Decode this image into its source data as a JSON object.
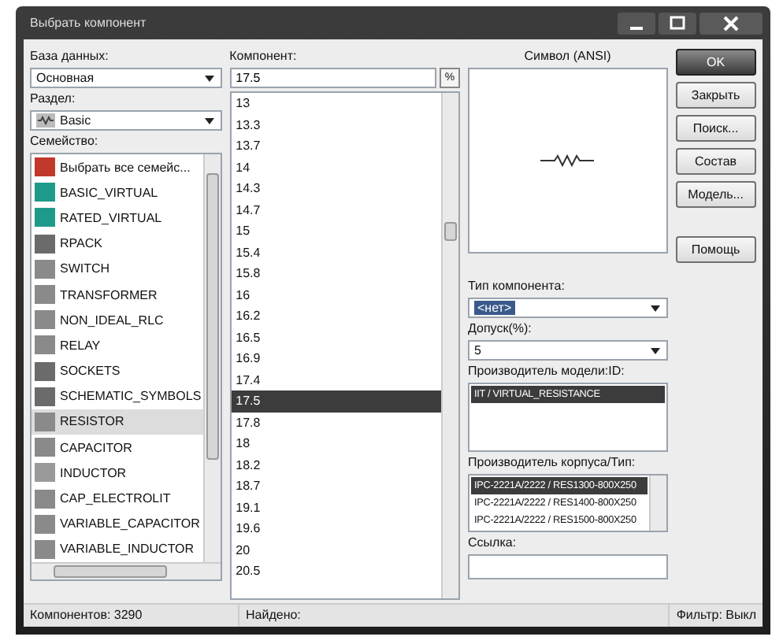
{
  "window": {
    "title": "Выбрать компонент"
  },
  "database": {
    "label": "База данных:",
    "value": "Основная"
  },
  "group": {
    "label": "Раздел:",
    "value": "Basic"
  },
  "family": {
    "label": "Семейство:",
    "items": [
      {
        "label": "Выбрать все семейс...",
        "color": "#c0392b",
        "selected": false
      },
      {
        "label": "BASIC_VIRTUAL",
        "color": "#1f9a8a",
        "selected": false
      },
      {
        "label": "RATED_VIRTUAL",
        "color": "#1f9a8a",
        "selected": false
      },
      {
        "label": "RPACK",
        "color": "#6b6b6b",
        "selected": false
      },
      {
        "label": "SWITCH",
        "color": "#8a8a8a",
        "selected": false
      },
      {
        "label": "TRANSFORMER",
        "color": "#8a8a8a",
        "selected": false
      },
      {
        "label": "NON_IDEAL_RLC",
        "color": "#8a8a8a",
        "selected": false
      },
      {
        "label": "RELAY",
        "color": "#8a8a8a",
        "selected": false
      },
      {
        "label": "SOCKETS",
        "color": "#6b6b6b",
        "selected": false
      },
      {
        "label": "SCHEMATIC_SYMBOLS",
        "color": "#6b6b6b",
        "selected": false
      },
      {
        "label": "RESISTOR",
        "color": "#8a8a8a",
        "selected": true
      },
      {
        "label": "CAPACITOR",
        "color": "#8a8a8a",
        "selected": false
      },
      {
        "label": "INDUCTOR",
        "color": "#9a9a9a",
        "selected": false
      },
      {
        "label": "CAP_ELECTROLIT",
        "color": "#8a8a8a",
        "selected": false
      },
      {
        "label": "VARIABLE_CAPACITOR",
        "color": "#8a8a8a",
        "selected": false
      },
      {
        "label": "VARIABLE_INDUCTOR",
        "color": "#8a8a8a",
        "selected": false
      }
    ]
  },
  "component": {
    "label": "Компонент:",
    "value": "17.5",
    "filter_button": "%",
    "items": [
      {
        "label": "13",
        "selected": false
      },
      {
        "label": "13.3",
        "selected": false
      },
      {
        "label": "13.7",
        "selected": false
      },
      {
        "label": "14",
        "selected": false
      },
      {
        "label": "14.3",
        "selected": false
      },
      {
        "label": "14.7",
        "selected": false
      },
      {
        "label": "15",
        "selected": false
      },
      {
        "label": "15.4",
        "selected": false
      },
      {
        "label": "15.8",
        "selected": false
      },
      {
        "label": "16",
        "selected": false
      },
      {
        "label": "16.2",
        "selected": false
      },
      {
        "label": "16.5",
        "selected": false
      },
      {
        "label": "16.9",
        "selected": false
      },
      {
        "label": "17.4",
        "selected": false
      },
      {
        "label": "17.5",
        "selected": true
      },
      {
        "label": "17.8",
        "selected": false
      },
      {
        "label": "18",
        "selected": false
      },
      {
        "label": "18.2",
        "selected": false
      },
      {
        "label": "18.7",
        "selected": false
      },
      {
        "label": "19.1",
        "selected": false
      },
      {
        "label": "19.6",
        "selected": false
      },
      {
        "label": "20",
        "selected": false
      },
      {
        "label": "20.5",
        "selected": false
      }
    ]
  },
  "symbol": {
    "label": "Символ (ANSI)"
  },
  "buttons": [
    {
      "label": "OK",
      "default": true
    },
    {
      "label": "Закрыть",
      "default": false
    },
    {
      "label": "Поиск...",
      "default": false
    },
    {
      "label": "Состав",
      "default": false
    },
    {
      "label": "Модель...",
      "default": false
    },
    {
      "label": "Помощь",
      "default": false
    }
  ],
  "component_type": {
    "label": "Тип компонента:",
    "value": "<нет>"
  },
  "tolerance": {
    "label": "Допуск(%):",
    "value": "5"
  },
  "model_manufacturer": {
    "label": "Производитель модели:ID:",
    "items": [
      {
        "label": "IIT / VIRTUAL_RESISTANCE",
        "selected": true
      }
    ]
  },
  "package_manufacturer": {
    "label": "Производитель корпуса/Тип:",
    "items": [
      {
        "label": "IPC-2221A/2222 / RES1300-800X250",
        "selected": true
      },
      {
        "label": "IPC-2221A/2222 / RES1400-800X250",
        "selected": false
      },
      {
        "label": "IPC-2221A/2222 / RES1500-800X250",
        "selected": false
      }
    ]
  },
  "hyperlink": {
    "label": "Ссылка:"
  },
  "status_bar": {
    "count": "Компонентов: 3290",
    "found": "Найдено:",
    "filter": "Фильтр: Выкл"
  }
}
